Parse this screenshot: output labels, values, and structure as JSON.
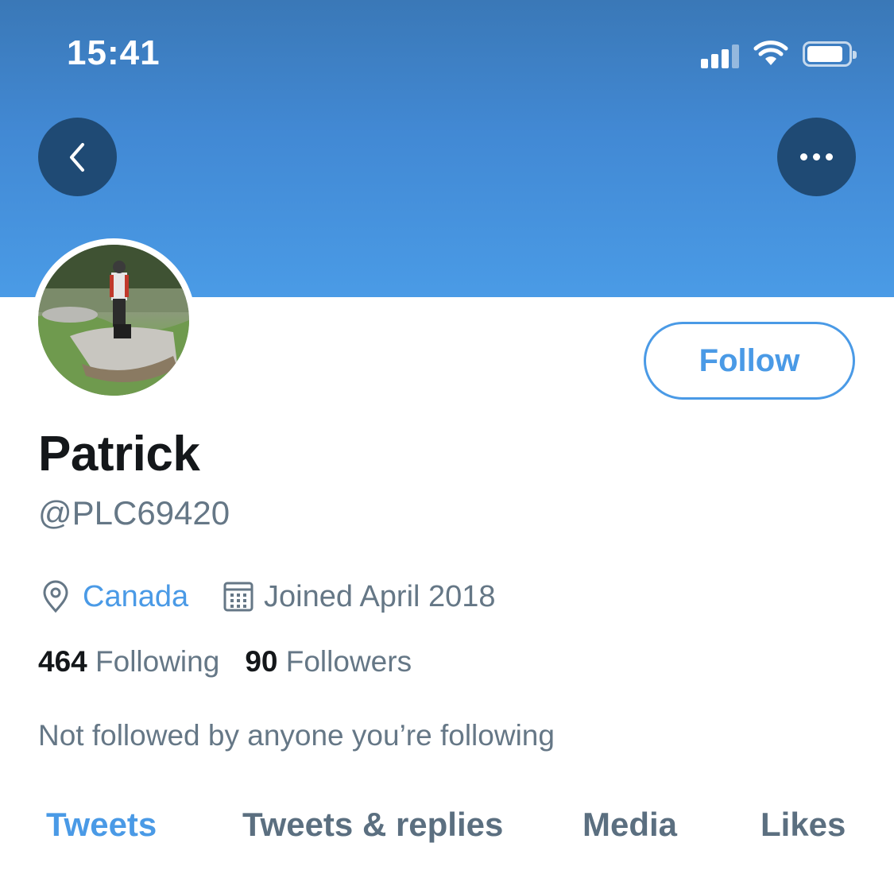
{
  "status_bar": {
    "time": "15:41"
  },
  "header": {
    "back_icon": "chevron-left-icon",
    "more_icon": "more-horizontal-icon",
    "banner_color": "#4a9be6"
  },
  "profile": {
    "name": "Patrick",
    "handle": "@PLC69420",
    "location": "Canada",
    "joined": "Joined April 2018",
    "following_count": "464",
    "following_label": "Following",
    "followers_count": "90",
    "followers_label": "Followers",
    "not_followed_text": "Not followed by anyone you’re following"
  },
  "actions": {
    "follow_label": "Follow"
  },
  "tabs": [
    {
      "label": "Tweets",
      "active": true
    },
    {
      "label": "Tweets & replies",
      "active": false
    },
    {
      "label": "Media",
      "active": false
    },
    {
      "label": "Likes",
      "active": false
    }
  ],
  "colors": {
    "accent": "#4a9ae6",
    "text": "#14171a",
    "secondary": "#657786",
    "button_dark": "#1f4a74"
  }
}
